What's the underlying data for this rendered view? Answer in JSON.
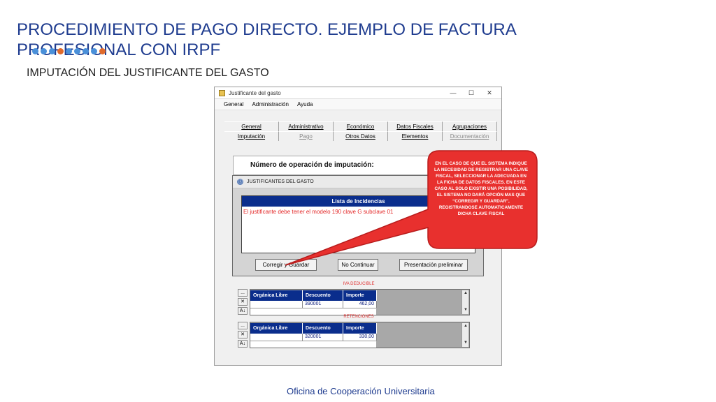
{
  "slide": {
    "title": "PROCEDIMIENTO DE PAGO DIRECTO. EJEMPLO DE FACTURA PROFESIONAL CON IRPF",
    "subtitle": "IMPUTACIÓN DEL JUSTIFICANTE DEL GASTO",
    "footer": "Oficina de Cooperación Universitaria",
    "dot_colors": [
      "#4a90d9",
      "#4a90d9",
      "#4a90d9",
      "#e06a2b",
      "#4a90d9",
      "#4a90d9",
      "#4a90d9",
      "#4a90d9",
      "#e06a2b"
    ]
  },
  "window": {
    "title": "Justificante del gasto",
    "minimize_symbol": "—",
    "maximize_symbol": "☐",
    "close_symbol": "✕",
    "menu": [
      "General",
      "Administración",
      "Ayuda"
    ],
    "tabs_row1": [
      "General",
      "Administrativo",
      "Económico",
      "Datos Fiscales",
      "Agrupaciones"
    ],
    "tabs_row2": [
      "Imputación",
      "Pago",
      "Otros Datos",
      "Elementos",
      "Documentación"
    ],
    "panel_label": "Número de operación de imputación:"
  },
  "dialog": {
    "title": "JUSTIFICANTES DEL GASTO",
    "icon": "ⓘ",
    "list_header": "Lista de Incidencias",
    "incidencias": [
      "El justificante debe tener el modelo 190 clave G subclave 01"
    ],
    "buttons": {
      "corregir": "Corregir y Guardar",
      "no_continuar": "No Continuar",
      "presentacion": "Presentación preliminar"
    }
  },
  "tables": {
    "iva": {
      "label": "IVA DEDUCIBLE",
      "headers": [
        "Orgánica Libre",
        "Descuento",
        "Importe"
      ],
      "row": [
        "",
        "390001",
        "462,00"
      ]
    },
    "retenciones": {
      "label": "RETENCIONES",
      "headers": [
        "Orgánica Libre",
        "Descuento",
        "Importe"
      ],
      "row": [
        "",
        "320001",
        "330,00"
      ]
    },
    "side_buttons": [
      "...",
      "✕",
      "A↓"
    ]
  },
  "callout": {
    "text": "EN EL CASO DE QUE EL SISTEMA INDIQUE LA NECESIDAD DE REGISTRAR UNA CLAVE FISCAL, SELECCIONAR LA ADECUADA EN LA FICHA DE DATOS FISCALES. EN ESTE CASO AL SOLO EXISTIR UNA POSIBILIDAD, EL SISTEMA NO DARÁ OPCIÓN MAS QUE “CORREGIR Y GUARDAR”, REGISTRANDOSE AUTOMATICAMENTE DICHA CLAVE FISCAL",
    "fill": "#e8302e",
    "stroke": "#b81c1c"
  }
}
